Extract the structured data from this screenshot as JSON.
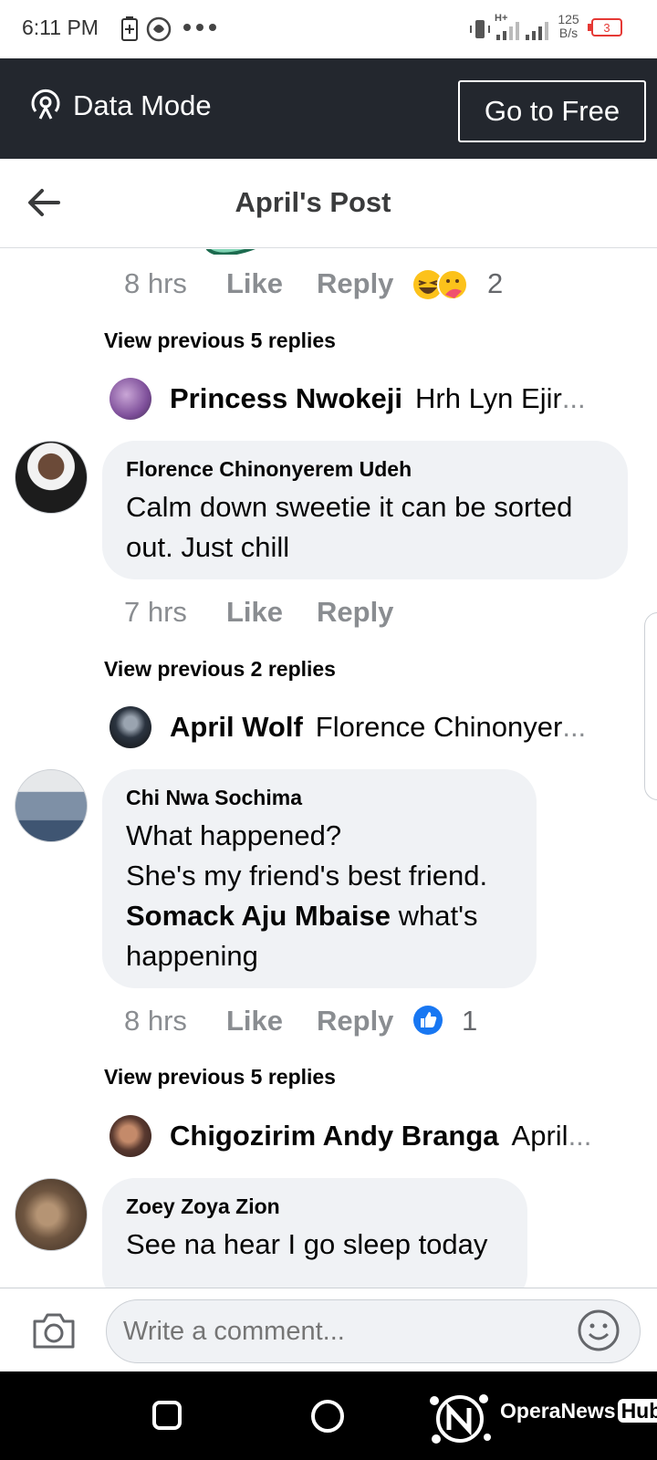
{
  "status_bar": {
    "time": "6:11 PM",
    "speed_value": "125",
    "speed_unit": "B/s",
    "network_label": "H+",
    "battery_level": "3",
    "battery_color": "#e53935"
  },
  "data_bar": {
    "label": "Data Mode",
    "button": "Go to Free"
  },
  "header": {
    "title": "April's Post"
  },
  "feed": {
    "top_meta": {
      "time": "8 hrs",
      "like": "Like",
      "reply": "Reply",
      "reactions": [
        "laughing-emoji-icon",
        "care-emoji-icon"
      ],
      "reaction_count": "2"
    },
    "threads": [
      {
        "view_previous": "View previous 5 replies",
        "reply_preview": {
          "name": "Princess Nwokeji",
          "text": "Hrh Lyn Ejir",
          "ellipsis": "..."
        },
        "comment": {
          "author": "Florence Chinonyerem Udeh",
          "lines": [
            "Calm down sweetie it can be sorted",
            "out. Just chill"
          ],
          "time": "7 hrs",
          "like": "Like",
          "reply": "Reply"
        }
      },
      {
        "view_previous": "View previous 2 replies",
        "reply_preview": {
          "name": "April Wolf",
          "text": "Florence Chinonyer",
          "ellipsis": "..."
        },
        "comment": {
          "author": "Chi Nwa Sochima",
          "line1": "What happened?",
          "line2": "She's my friend's best friend.",
          "mention": "Somack Aju Mbaise",
          "line3_rest": " what's",
          "line4": "happening",
          "time": "8 hrs",
          "like": "Like",
          "reply": "Reply",
          "reaction": "like-reaction-icon",
          "reaction_count": "1"
        }
      },
      {
        "view_previous": "View previous 5 replies",
        "reply_preview": {
          "name": "Chigozirim Andy Branga",
          "text": "April",
          "ellipsis": "..."
        },
        "comment": {
          "author": "Zoey Zoya Zion",
          "lines": [
            "See na hear I go sleep today"
          ]
        }
      }
    ]
  },
  "composer": {
    "placeholder": "Write a comment..."
  },
  "watermark": {
    "text": "OperaNews",
    "hub": "Hub"
  },
  "colors": {
    "data_bar_bg": "#23272e",
    "bubble_bg": "#f0f2f5",
    "meta_text": "#8a8d91",
    "like_blue": "#1877f2"
  }
}
